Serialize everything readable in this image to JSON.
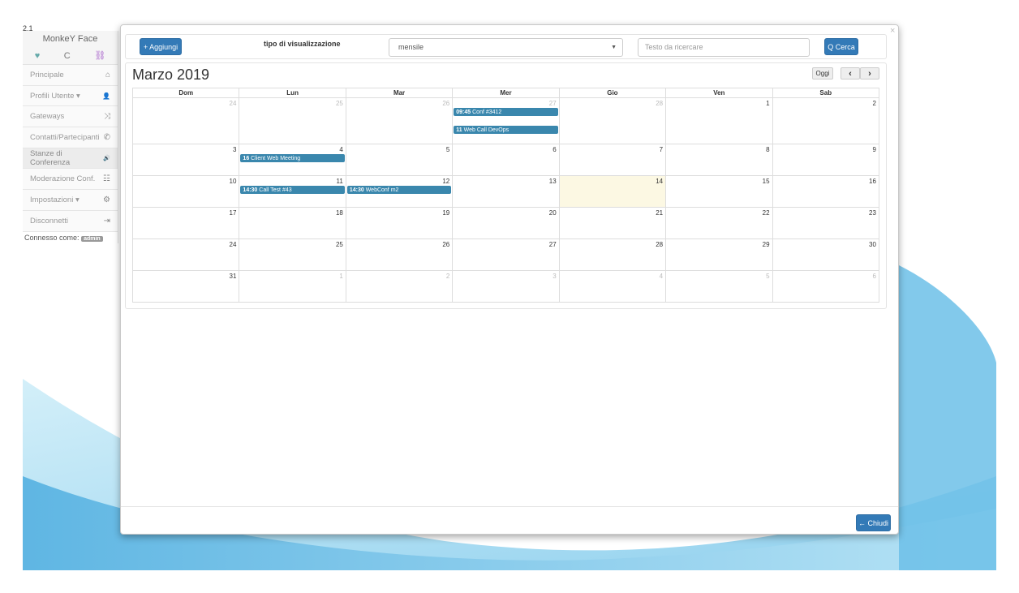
{
  "version": "2.1",
  "sidebar": {
    "app_name": "MonkeY Face",
    "tools": [
      {
        "icon": "heartbeat-icon",
        "glyph": "♥"
      },
      {
        "icon": "refresh-icon",
        "glyph": "C"
      },
      {
        "icon": "link-icon",
        "glyph": "⛓"
      }
    ],
    "items": [
      {
        "label": "Principale",
        "icon": "home-icon",
        "glyph": "⌂"
      },
      {
        "label": "Profili Utente ▾",
        "icon": "user-icon",
        "glyph": "👤"
      },
      {
        "label": "Gateways",
        "icon": "random-icon",
        "glyph": "⤨"
      },
      {
        "label": "Contatti/Partecipanti",
        "icon": "phone-icon",
        "glyph": "✆"
      },
      {
        "label": "Stanze di Conferenza",
        "icon": "volume-icon",
        "glyph": "🔊"
      },
      {
        "label": "Moderazione Conf.",
        "icon": "tasks-icon",
        "glyph": "☷"
      },
      {
        "label": "Impostazioni ▾",
        "icon": "cog-icon",
        "glyph": "⚙"
      },
      {
        "label": "Disconnetti",
        "icon": "logout-icon",
        "glyph": "⇥"
      }
    ],
    "connected_label": "Connesso come:",
    "connected_user": "admin"
  },
  "toolbar": {
    "add_label": "+ Aggiungi",
    "view_label": "tipo di visualizzazione",
    "view_value": "mensile",
    "search_placeholder": "Testo da ricercare",
    "search_label": "Q Cerca"
  },
  "calendar": {
    "title": "Marzo 2019",
    "today_label": "Oggi",
    "prev_label": "‹",
    "next_label": "›",
    "days_of_week": [
      "Dom",
      "Lun",
      "Mar",
      "Mer",
      "Gio",
      "Ven",
      "Sab"
    ],
    "weeks": [
      [
        {
          "n": "24",
          "o": true
        },
        {
          "n": "25",
          "o": true
        },
        {
          "n": "26",
          "o": true
        },
        {
          "n": "27",
          "o": true
        },
        {
          "n": "28",
          "o": true
        },
        {
          "n": "1"
        },
        {
          "n": "2"
        }
      ],
      [
        {
          "n": "3"
        },
        {
          "n": "4"
        },
        {
          "n": "5"
        },
        {
          "n": "6"
        },
        {
          "n": "7"
        },
        {
          "n": "8"
        },
        {
          "n": "9"
        }
      ],
      [
        {
          "n": "10"
        },
        {
          "n": "11"
        },
        {
          "n": "12"
        },
        {
          "n": "13"
        },
        {
          "n": "14",
          "today": true
        },
        {
          "n": "15"
        },
        {
          "n": "16"
        }
      ],
      [
        {
          "n": "17"
        },
        {
          "n": "18"
        },
        {
          "n": "19"
        },
        {
          "n": "20"
        },
        {
          "n": "21"
        },
        {
          "n": "22"
        },
        {
          "n": "23"
        }
      ],
      [
        {
          "n": "24"
        },
        {
          "n": "25"
        },
        {
          "n": "26"
        },
        {
          "n": "27"
        },
        {
          "n": "28"
        },
        {
          "n": "29"
        },
        {
          "n": "30"
        }
      ],
      [
        {
          "n": "31"
        },
        {
          "n": "1",
          "o": true
        },
        {
          "n": "2",
          "o": true
        },
        {
          "n": "3",
          "o": true
        },
        {
          "n": "4",
          "o": true
        },
        {
          "n": "5",
          "o": true
        },
        {
          "n": "6",
          "o": true
        }
      ]
    ],
    "events": [
      {
        "week": 0,
        "day": 3,
        "slot": 0,
        "time": "09:45",
        "title": "Conf #3412"
      },
      {
        "week": 0,
        "day": 3,
        "slot": 1,
        "time": "11",
        "title": "Web Call DevOps"
      },
      {
        "week": 1,
        "day": 1,
        "slot": 0,
        "time": "16",
        "title": "Client Web Meeting"
      },
      {
        "week": 2,
        "day": 1,
        "slot": 0,
        "time": "14:30",
        "title": "Call Test #43"
      },
      {
        "week": 2,
        "day": 2,
        "slot": 0,
        "time": "14:30",
        "title": "WebConf m2"
      }
    ]
  },
  "footer": {
    "close_label": "← Chiudi"
  },
  "modal_close_glyph": "×",
  "colors": {
    "primary": "#337ab7",
    "event": "#3a87ad",
    "today": "#fcf8e3"
  }
}
